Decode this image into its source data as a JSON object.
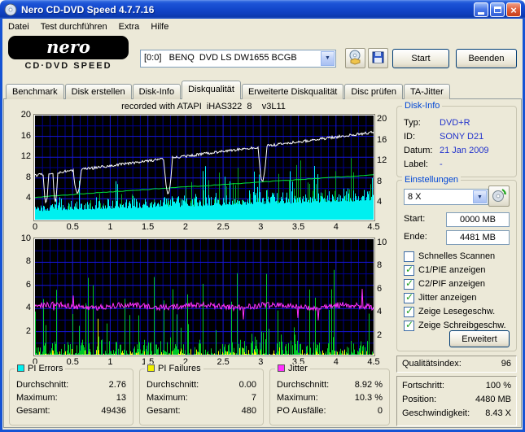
{
  "window": {
    "title": "Nero CD-DVD Speed 4.7.7.16"
  },
  "menu": {
    "items": [
      {
        "label": "Datei"
      },
      {
        "label": "Test durchführen"
      },
      {
        "label": "Extra"
      },
      {
        "label": "Hilfe"
      }
    ]
  },
  "toolbar": {
    "logo": {
      "line1": "nero",
      "line2": "CD·DVD SPEED"
    },
    "drive_select": {
      "value": "[0:0]   BENQ  DVD LS DW1655 BCGB"
    },
    "start_label": "Start",
    "quit_label": "Beenden"
  },
  "tabs": {
    "items": [
      {
        "label": "Benchmark"
      },
      {
        "label": "Disk erstellen"
      },
      {
        "label": "Disk-Info"
      },
      {
        "label": "Diskqualität",
        "active": true
      },
      {
        "label": "Erweiterte Diskqualität"
      },
      {
        "label": "Disc prüfen"
      },
      {
        "label": "TA-Jitter"
      }
    ]
  },
  "recorded_note": "recorded with ATAPI  iHAS322  8    v3L11",
  "disk_info": {
    "title": "Disk-Info",
    "rows": [
      {
        "label": "Typ:",
        "value": "DVD+R"
      },
      {
        "label": "ID:",
        "value": "SONY D21"
      },
      {
        "label": "Datum:",
        "value": "21 Jan 2009"
      },
      {
        "label": "Label:",
        "value": "-"
      }
    ]
  },
  "settings": {
    "title": "Einstellungen",
    "speed_select": "8 X",
    "start": {
      "label": "Start:",
      "value": "0000 MB"
    },
    "end": {
      "label": "Ende:",
      "value": "4481 MB"
    },
    "checkboxes": [
      {
        "label": "Schnelles Scannen",
        "mark": ""
      },
      {
        "label": "C1/PIE anzeigen",
        "mark": "✓"
      },
      {
        "label": "C2/PIF anzeigen",
        "mark": "✓"
      },
      {
        "label": "Jitter anzeigen",
        "mark": "✓"
      },
      {
        "label": "Zeige Lesegeschw.",
        "mark": "✓"
      },
      {
        "label": "Zeige Schreibgeschw.",
        "mark": "✓"
      }
    ],
    "advanced_label": "Erweitert"
  },
  "quality_index": {
    "label": "Qualitätsindex:",
    "value": "96"
  },
  "progress": {
    "rows": [
      {
        "label": "Fortschritt:",
        "value": "100 %"
      },
      {
        "label": "Position:",
        "value": "4480 MB"
      },
      {
        "label": "Geschwindigkeit:",
        "value": "8.43 X"
      }
    ]
  },
  "stats_panels": [
    {
      "title": "PI Errors",
      "swatch": "#00F0F0",
      "rows": [
        {
          "label": "Durchschnitt:",
          "value": "2.76"
        },
        {
          "label": "Maximum:",
          "value": "13"
        },
        {
          "label": "Gesamt:",
          "value": "49436"
        }
      ]
    },
    {
      "title": "PI Failures",
      "swatch": "#F0F000",
      "rows": [
        {
          "label": "Durchschnitt:",
          "value": "0.00"
        },
        {
          "label": "Maximum:",
          "value": "7"
        },
        {
          "label": "Gesamt:",
          "value": "480"
        }
      ]
    },
    {
      "title": "Jitter",
      "swatch": "#FF30FF",
      "rows": [
        {
          "label": "Durchschnitt:",
          "value": "8.92 %"
        },
        {
          "label": "Maximum:",
          "value": "10.3 %"
        },
        {
          "label": "PO Ausfälle:",
          "value": "0"
        }
      ]
    }
  ],
  "chart_data": [
    {
      "kind": "top",
      "type": "bar",
      "title": "PI Errors",
      "background": "#000000",
      "seed": 20090121,
      "x": {
        "min": 0,
        "max": 4.5,
        "ticks": [
          "0",
          "0.5",
          "1",
          "1.5",
          "2",
          "2.5",
          "3",
          "3.5",
          "4",
          "4.5"
        ]
      },
      "y_left": {
        "min": 0,
        "max": 20,
        "ticks": [
          "20",
          "16",
          "12",
          "8",
          "4"
        ]
      },
      "y_right": {
        "ticks": [
          "20",
          "16",
          "12",
          "8",
          "4"
        ]
      },
      "grid": {
        "x_minor": 0.1,
        "x_major": 0.5,
        "y_minor": 2,
        "y_major": 4,
        "minor_color": "#00008E",
        "major_color": "#1616D8"
      },
      "series": [
        {
          "name": "PI Errors (C1/PIE)",
          "style": "bars",
          "color": "#00F0F0",
          "average": 2.76,
          "maximum": 13,
          "total": 49436
        },
        {
          "name": "PIE Spitzen",
          "style": "bars",
          "color": "#00A428"
        },
        {
          "name": "Lesegeschwindigkeit",
          "style": "line",
          "color": "#FFFFFF",
          "start_speed_x": 4.3,
          "end_speed_x": 8.43
        },
        {
          "name": "Schreibgeschwindigkeit",
          "style": "line",
          "color": "#00E83C"
        }
      ]
    },
    {
      "kind": "bottom",
      "type": "bar",
      "title": "PI Failures / Jitter",
      "background": "#000000",
      "seed": 4481,
      "x": {
        "min": 0,
        "max": 4.5,
        "ticks": [
          "0",
          "0.5",
          "1",
          "1.5",
          "2",
          "2.5",
          "3",
          "3.5",
          "4",
          "4.5"
        ]
      },
      "y_left": {
        "min": 0,
        "max": 10,
        "ticks": [
          "10",
          "8",
          "6",
          "4",
          "2"
        ]
      },
      "y_right": {
        "ticks": [
          "10",
          "8",
          "6",
          "4",
          "2"
        ]
      },
      "grid": {
        "x_minor": 0.1,
        "x_major": 0.5,
        "y_minor": 1,
        "y_major": 2,
        "minor_color": "#00008E",
        "major_color": "#1616D8"
      },
      "series": [
        {
          "name": "PI Failures (C2/PIF)",
          "style": "bars",
          "color": "#F0F000",
          "average": 0.0,
          "maximum": 7,
          "total": 480
        },
        {
          "name": "PIF Spitzen",
          "style": "bars",
          "color": "#00C828"
        },
        {
          "name": "Jitter",
          "style": "line",
          "color": "#FF30FF",
          "average_pct": 8.92,
          "maximum_pct": 10.3
        }
      ]
    }
  ]
}
